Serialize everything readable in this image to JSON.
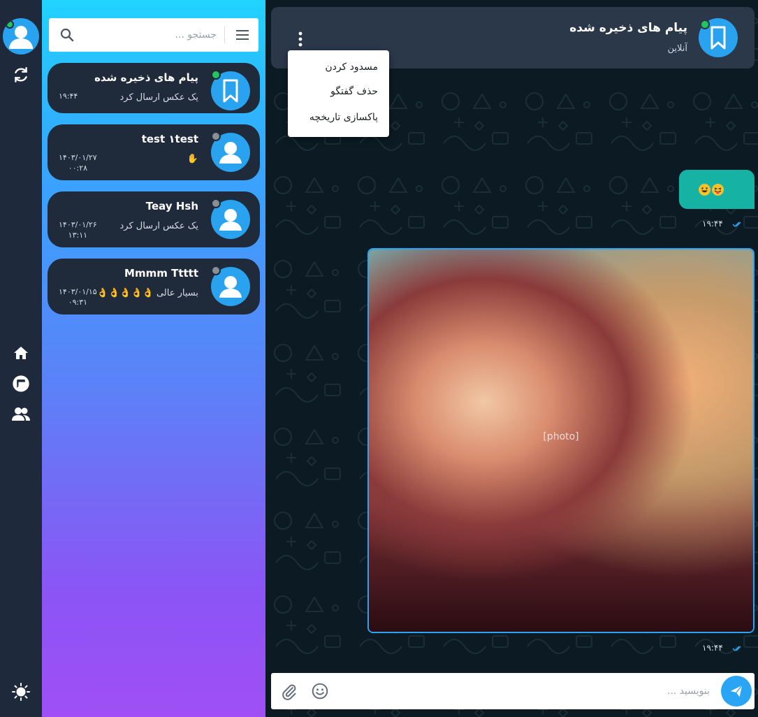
{
  "search": {
    "placeholder": "جستجو ..."
  },
  "chats": [
    {
      "name": "پیام های ذخیره شده",
      "preview": "یک عکس ارسال کرد",
      "date": "",
      "time": "۱۹:۴۴",
      "online": true,
      "avatar": "bookmark-icon"
    },
    {
      "name": "test‏۱ test",
      "preview": "✋",
      "date": "۱۴۰۳/۰۱/۲۷",
      "time": "۰۰:۲۸",
      "online": false,
      "avatar": "user-icon"
    },
    {
      "name": "Teay Hsh",
      "preview": "یک عکس ارسال کرد",
      "date": "۱۴۰۳/۰۱/۲۶",
      "time": "۱۳:۱۱",
      "online": false,
      "avatar": "user-icon"
    },
    {
      "name": "Mmmm Ttttt",
      "preview": "بسیار عالی 👌👌👌👌👌",
      "date": "۱۴۰۳/۰۱/۱۵",
      "time": "۰۹:۳۱",
      "online": false,
      "avatar": "user-icon"
    }
  ],
  "header": {
    "title": "پیام های ذخیره شده",
    "status": "آنلاین"
  },
  "menu": {
    "block": "مسدود کردن",
    "delete_chat": "حذف گفتگو",
    "clear_history": "پاکسازی تاریخچه"
  },
  "messages": [
    {
      "type": "emoji",
      "content": [
        "grinning-face",
        "tongue-face"
      ],
      "time": "۱۹:۴۴"
    },
    {
      "type": "image",
      "caption": "",
      "time": "۱۹:۴۴"
    }
  ],
  "composer": {
    "placeholder": "بنویسید ..."
  },
  "colors": {
    "accent": "#2aa5f5",
    "online": "#22c55e",
    "offline": "#8a8f96",
    "bubble": "#16b3a4",
    "rail": "#1e2a3c"
  },
  "icons": {
    "rail": [
      "refresh-icon",
      "home-icon",
      "chats-icon",
      "contacts-icon",
      "theme-icon"
    ]
  }
}
